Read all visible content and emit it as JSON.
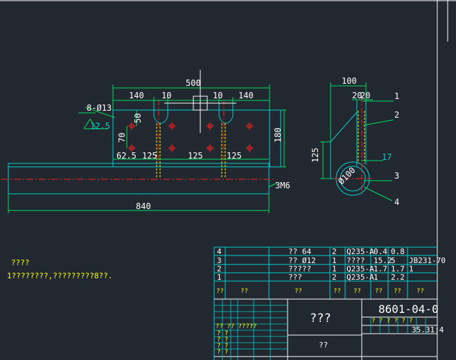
{
  "front_view": {
    "dims": {
      "top_total": "500",
      "top_left": "140",
      "top_mid_left": "10",
      "top_mid_right": "10",
      "top_right": "140",
      "hole_callout": "8-Ø13",
      "roughness": "12.5",
      "vertical_70": "70",
      "vertical_50": "50",
      "height_180": "180",
      "bottom_62_5": "62.5",
      "bottom_125_a": "125",
      "bottom_125_b": "125",
      "bottom_125_c": "125",
      "overall_length": "840",
      "end_mark": "3M6"
    }
  },
  "side_view": {
    "dims": {
      "width_100": "100",
      "width_20": "20",
      "width_20b": "20",
      "height_125": "125",
      "dia": "Ø100",
      "angle": "17"
    },
    "balloons": [
      "1",
      "2",
      "3",
      "4"
    ]
  },
  "notes": {
    "title": "????",
    "line1": "1????????,?????????8??."
  },
  "bom": {
    "rows": [
      {
        "no": "4",
        "name": "??  64",
        "qty": "2",
        "material": "Q235-A",
        "unit": "0.4",
        "total": "0.8",
        "note": ""
      },
      {
        "no": "3",
        "name": "??  Ø12",
        "qty": "1",
        "material": "????",
        "unit": "15.2",
        "total": "5",
        "note": "JB231-70"
      },
      {
        "no": "2",
        "name": "?????",
        "qty": "1",
        "material": "Q235-A",
        "unit": "1.7",
        "total": "1.7",
        "note": "1"
      },
      {
        "no": "1",
        "name": "???",
        "qty": "2",
        "material": "Q235-A",
        "unit": "1",
        "total": "2.2",
        "note": ""
      }
    ],
    "header": [
      "??",
      "??",
      "??",
      "??",
      "??",
      "??",
      "??",
      "??"
    ]
  },
  "title_block": {
    "part_name": "???",
    "drawing_no": "8601-04-0",
    "company": "??",
    "scale_row": "35.31:4",
    "small_labels": [
      "? ? ? ? ? ?",
      "?? ?? ?????",
      "? ?",
      "? ?",
      "? ?",
      "? ?"
    ]
  },
  "colors": {
    "background": "#212830",
    "outline": "#00d2d2",
    "dimension": "#00e060",
    "center": "#ff2020",
    "hidden": "#ffff00",
    "text": "#ffffff",
    "leader": "#00e060"
  }
}
